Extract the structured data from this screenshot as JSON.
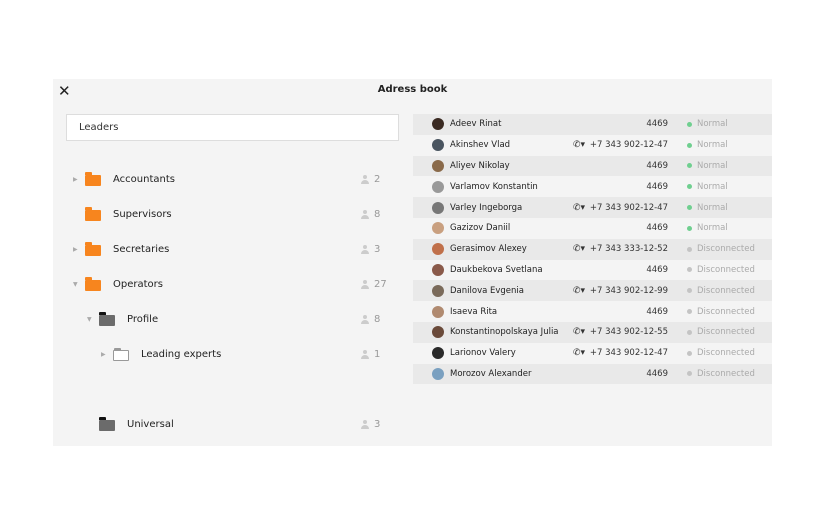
{
  "header": {
    "title": "Adress book",
    "close_icon": "close-icon"
  },
  "search": {
    "value": "Leaders"
  },
  "tree": [
    {
      "label": "Accountants",
      "count": "2",
      "expanded": false,
      "has_children": true
    },
    {
      "label": "Supervisors",
      "count": "8",
      "has_children": false
    },
    {
      "label": "Secretaries",
      "count": "3",
      "expanded": false,
      "has_children": true
    },
    {
      "label": "Operators",
      "count": "27",
      "expanded": true,
      "has_children": true
    },
    {
      "label": "Profile",
      "count": "8",
      "expanded": true,
      "has_children": true
    },
    {
      "label": "Leading experts",
      "count": "1",
      "expanded": false,
      "has_children": true
    },
    {
      "label": "Universal",
      "count": "3",
      "has_children": false
    }
  ],
  "contacts": [
    {
      "name": "Adeev Rinat",
      "phone": "",
      "number": "4469",
      "status": "Normal"
    },
    {
      "name": "Akinshev Vlad",
      "phone": "yes",
      "number": "+7 343 902-12-47",
      "status": "Normal"
    },
    {
      "name": "Aliyev Nikolay",
      "phone": "",
      "number": "4469",
      "status": "Normal"
    },
    {
      "name": "Varlamov Konstantin",
      "phone": "",
      "number": "4469",
      "status": "Normal"
    },
    {
      "name": "Varley Ingeborga",
      "phone": "yes",
      "number": "+7 343 902-12-47",
      "status": "Normal"
    },
    {
      "name": "Gazizov Daniil",
      "phone": "",
      "number": "4469",
      "status": "Normal"
    },
    {
      "name": "Gerasimov Alexey",
      "phone": "yes",
      "number": "+7 343 333-12-52",
      "status": "Disconnected"
    },
    {
      "name": "Daukbekova Svetlana",
      "phone": "",
      "number": "4469",
      "status": "Disconnected"
    },
    {
      "name": "Danilova Evgenia",
      "phone": "yes",
      "number": "+7 343 902-12-99",
      "status": "Disconnected"
    },
    {
      "name": "Isaeva Rita",
      "phone": "",
      "number": "4469",
      "status": "Disconnected"
    },
    {
      "name": "Konstantinopolskaya Julia",
      "phone": "yes",
      "number": "+7 343 902-12-55",
      "status": "Disconnected"
    },
    {
      "name": "Larionov Valery",
      "phone": "yes",
      "number": "+7 343 902-12-47",
      "status": "Disconnected"
    },
    {
      "name": "Morozov Alexander",
      "phone": "",
      "number": "4469",
      "status": "Disconnected"
    }
  ],
  "colors": {
    "normal": "#6fcf8f",
    "disconnected": "#c4c4c4",
    "folder": "#f7851e"
  }
}
